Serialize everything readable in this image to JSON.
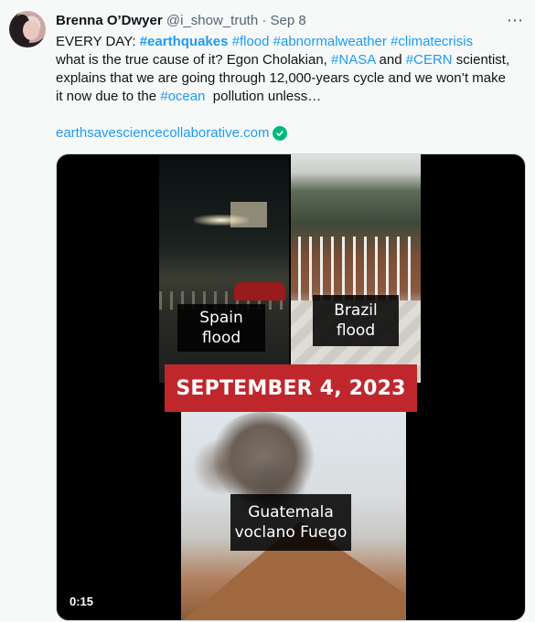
{
  "tweet": {
    "author_name": "Brenna O’Dwyer",
    "handle": "@i_show_truth",
    "separator": "·",
    "date": "Sep 8",
    "more_icon": "more-horizontal-icon",
    "text": {
      "line1_prefix": "EVERY DAY: ",
      "line1_tags": [
        "#earthquakes",
        "#flood",
        "#abnormalweather",
        "#climatecrisis"
      ],
      "line2_start": "what is the true cause of it? Egon Cholakian, ",
      "line2_tag1": "#NASA",
      "line2_mid": " and ",
      "line2_tag2": "#CERN",
      "line2_end": " scientist,",
      "line3": "explains that we are going through 12,000-years cycle and we won’t make",
      "line4_start": "it now due to the ",
      "line4_tag": "#ocean",
      "line4_end": "  pollution unless…"
    },
    "link": "earthsavesciencecollaborative.com",
    "link_icon": "verified-check-icon"
  },
  "media": {
    "spain_label_1": "Spain",
    "spain_label_2": "flood",
    "brazil_label_1": "Brazil",
    "brazil_label_2": "flood",
    "banner": "SEPTEMBER 4, 2023",
    "guatemala_label_1": "Guatemala",
    "guatemala_label_2": "voclano Fuego",
    "duration": "0:15"
  },
  "colors": {
    "link": "#1d9bf0",
    "banner": "#c0272d",
    "verified": "#00ba7c"
  }
}
